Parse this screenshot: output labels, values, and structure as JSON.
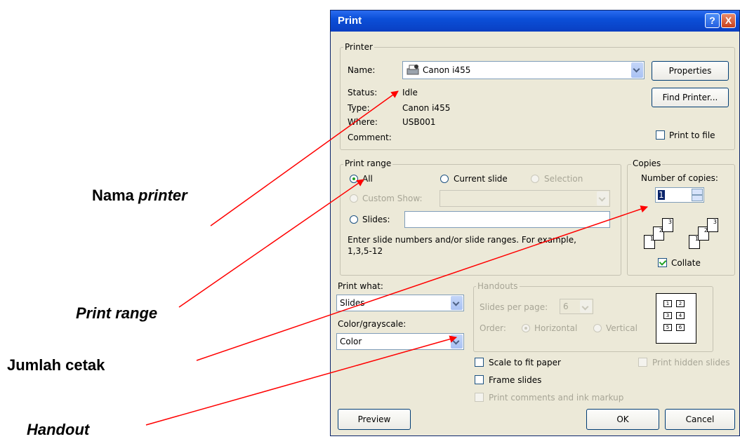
{
  "annotations": {
    "printer_name": {
      "plain": "Nama ",
      "italic": "printer"
    },
    "print_range": "Print range",
    "copies": "Jumlah cetak",
    "handout": "Handout"
  },
  "dialog": {
    "title": "Print",
    "help_label": "?",
    "close_label": "X",
    "printer": {
      "group_label": "Printer",
      "name_label": "Name:",
      "name_value": "Canon i455",
      "status_label": "Status:",
      "status_value": "Idle",
      "type_label": "Type:",
      "type_value": "Canon i455",
      "where_label": "Where:",
      "where_value": "USB001",
      "comment_label": "Comment:",
      "properties_button": "Properties",
      "find_printer_button": "Find Printer...",
      "print_to_file_label": "Print to file",
      "print_to_file_checked": false
    },
    "print_range": {
      "group_label": "Print range",
      "all_label": "All",
      "current_slide_label": "Current slide",
      "selection_label": "Selection",
      "custom_show_label": "Custom Show:",
      "slides_label": "Slides:",
      "slides_value": "",
      "hint": "Enter slide numbers and/or slide ranges. For example,",
      "hint_example": "1,3,5-12",
      "selected": "All"
    },
    "copies": {
      "group_label": "Copies",
      "number_label": "Number of copies:",
      "number_value": "1",
      "collate_label": "Collate",
      "collate_checked": true,
      "page_numbers": [
        "1",
        "2",
        "3"
      ]
    },
    "print_what": {
      "label": "Print what:",
      "value": "Slides",
      "color_label": "Color/grayscale:",
      "color_value": "Color"
    },
    "handouts": {
      "group_label": "Handouts",
      "slides_per_page_label": "Slides per page:",
      "slides_per_page_value": "6",
      "order_label": "Order:",
      "horizontal_label": "Horizontal",
      "vertical_label": "Vertical",
      "preview_cells": [
        "1",
        "2",
        "3",
        "4",
        "5",
        "6"
      ]
    },
    "options": {
      "scale_to_fit": "Scale to fit paper",
      "frame_slides": "Frame slides",
      "print_comments": "Print comments and ink markup",
      "print_hidden": "Print hidden slides"
    },
    "buttons": {
      "preview": "Preview",
      "ok": "OK",
      "cancel": "Cancel"
    },
    "colors": {
      "title_bar": "#0b4fd8",
      "dialog_bg": "#ece9d8",
      "arrow": "#ff0000"
    }
  }
}
